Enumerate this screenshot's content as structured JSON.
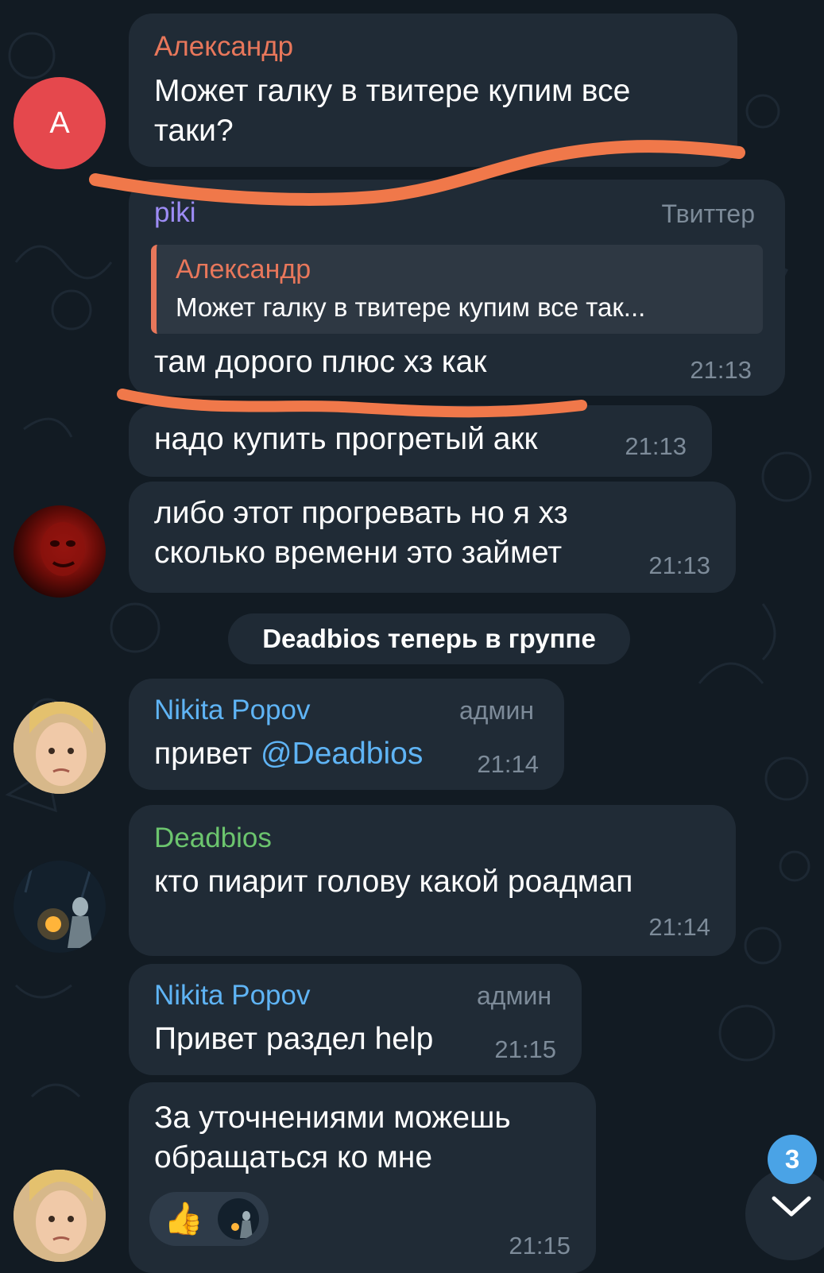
{
  "messages": {
    "m1": {
      "sender": "Александр",
      "text_line1": "Может галку в твитере купим все",
      "text_line2": "таки?",
      "avatar_letter": "A"
    },
    "m2": {
      "sender": "piki",
      "topic": "Твиттер",
      "reply_sender": "Александр",
      "reply_text": "Может галку в твитере купим все так...",
      "text": "там дорого плюс хз как",
      "time": "21:13"
    },
    "m3": {
      "text": "надо купить прогретый акк",
      "time": "21:13"
    },
    "m4": {
      "text_line1": "либо этот прогревать но я хз",
      "text_line2": "сколько времени это займет",
      "time": "21:13"
    },
    "system": {
      "text": "Deadbios теперь в группе"
    },
    "m5": {
      "sender": "Nikita Popov",
      "role": "админ",
      "text": "привет ",
      "mention": "@Deadbios",
      "time": "21:14"
    },
    "m6": {
      "sender": "Deadbios",
      "text": "кто пиарит голову какой роадмап",
      "time": "21:14"
    },
    "m7": {
      "sender": "Nikita Popov",
      "role": "админ",
      "text": "Привет раздел help",
      "time": "21:15"
    },
    "m8": {
      "text_line1": "За уточнениями можешь",
      "text_line2": "обращаться ко мне",
      "reaction": "👍",
      "time": "21:15"
    }
  },
  "scroll_badge": "3",
  "colors": {
    "background": "#121b23",
    "bubble": "#202b36",
    "sender_aleksandr": "#e8775b",
    "sender_piki": "#9d8cf5",
    "sender_nikita": "#5fb4f5",
    "sender_deadbios": "#6cc56e",
    "annotation": "#f0784a"
  }
}
